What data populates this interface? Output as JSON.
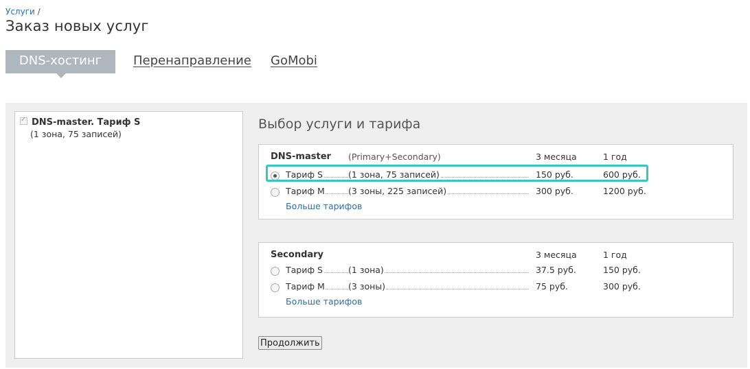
{
  "breadcrumb": {
    "link": "Услуги",
    "separator": "/"
  },
  "page_title": "Заказ новых услуг",
  "tabs": {
    "dns_hosting": "DNS-хостинг",
    "redirect": "Перенаправление",
    "gomobi": "GoMobi"
  },
  "cart": {
    "item_title": "DNS-master. Тариф S",
    "item_sub": "(1 зона, 75 записей)"
  },
  "section_title": "Выбор услуги и тарифа",
  "dns_master": {
    "name": "DNS-master",
    "desc": "(Primary+Secondary)",
    "col1": "3 месяца",
    "col2": "1 год",
    "rows": [
      {
        "name": "Тариф S",
        "desc": "(1 зона, 75 записей)",
        "price3": "150 руб.",
        "price12": "600 руб.",
        "selected": true
      },
      {
        "name": "Тариф M",
        "desc": "(3 зоны, 225 записей)",
        "price3": "300 руб.",
        "price12": "1200 руб.",
        "selected": false
      }
    ],
    "more": "Больше тарифов"
  },
  "secondary": {
    "name": "Secondary",
    "col1": "3 месяца",
    "col2": "1 год",
    "rows": [
      {
        "name": "Тариф S",
        "desc": "(1 зона)",
        "price3": "37.5 руб.",
        "price12": "150 руб.",
        "selected": false
      },
      {
        "name": "Тариф M",
        "desc": "(3 зоны)",
        "price3": "75 руб.",
        "price12": "300 руб.",
        "selected": false
      }
    ],
    "more": "Больше тарифов"
  },
  "continue_label": "Продолжить",
  "colors": {
    "highlight": "#36c7bd",
    "active_tab": "#aeb7bd",
    "link": "#2a6fb0"
  }
}
